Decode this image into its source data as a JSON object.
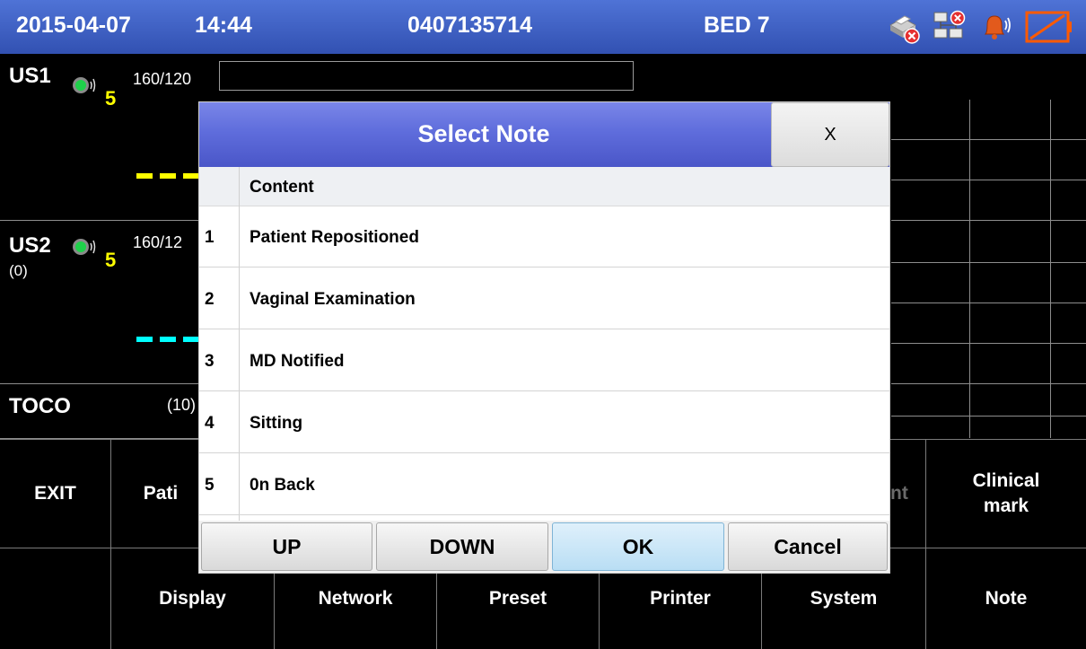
{
  "header": {
    "date": "2015-04-07",
    "time": "14:44",
    "patient_id": "0407135714",
    "bed": "BED 7",
    "icons": [
      "printer-error-icon",
      "network-error-icon",
      "alarm-bell-icon",
      "battery-empty-icon"
    ]
  },
  "channels": {
    "us1": {
      "label": "US1",
      "volume": "5",
      "scale": "160/120"
    },
    "us2": {
      "label": "US2",
      "sub": "(0)",
      "volume": "5",
      "scale": "160/12"
    },
    "toco": {
      "label": "TOCO",
      "scale": "(10)"
    }
  },
  "menu": {
    "exit": "EXIT",
    "patient": "Pati",
    "hidden_right": "nt",
    "clinical_mark_1": "Clinical",
    "clinical_mark_2": "mark",
    "display": "Display",
    "network": "Network",
    "preset": "Preset",
    "printer": "Printer",
    "system": "System",
    "note": "Note"
  },
  "dialog": {
    "title": "Select Note",
    "close": "X",
    "column_header": "Content",
    "items": [
      {
        "num": "1",
        "text": "Patient Repositioned"
      },
      {
        "num": "2",
        "text": "Vaginal Examination"
      },
      {
        "num": "3",
        "text": "MD Notified"
      },
      {
        "num": "4",
        "text": "Sitting"
      },
      {
        "num": "5",
        "text": "0n Back"
      }
    ],
    "buttons": {
      "up": "UP",
      "down": "DOWN",
      "ok": "OK",
      "cancel": "Cancel"
    },
    "selected_button": "OK"
  },
  "colors": {
    "header_blue": "#3f62c8",
    "us1_trace": "#ffff00",
    "us2_trace": "#00ffff",
    "volume_text": "#ffff00"
  }
}
